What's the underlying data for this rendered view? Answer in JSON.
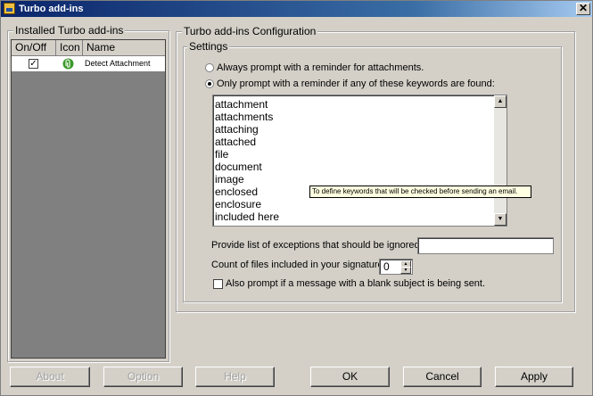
{
  "window": {
    "title": "Turbo add-ins",
    "close_glyph": "✕"
  },
  "installed": {
    "group_title": "Installed Turbo add-ins",
    "columns": [
      "On/Off",
      "Icon",
      "Name"
    ],
    "rows": [
      {
        "enabled": true,
        "icon": "paperclip-icon",
        "name": "Detect Attachment"
      }
    ]
  },
  "config": {
    "group_title": "Turbo add-ins Configuration",
    "settings_title": "Settings",
    "radio_always": "Always prompt with a reminder for attachments.",
    "radio_keywords": "Only prompt with a reminder if any of these keywords are found:",
    "selected_radio": "keywords",
    "keywords": [
      "attachment",
      "attachments",
      "attaching",
      "attached",
      "file",
      "document",
      "image",
      "enclosed",
      "enclosure",
      "included here"
    ],
    "tooltip": "To define keywords that will be checked before sending an email.",
    "exceptions_label": "Provide list of exceptions that should be ignored :",
    "exceptions_value": "",
    "signature_files_label": "Count of files included in your signature:",
    "signature_files_value": "0",
    "blank_subject_label": "Also prompt if a message with a blank subject is being sent.",
    "blank_subject_checked": false
  },
  "buttons": {
    "about": "About",
    "option": "Option",
    "help": "Help",
    "ok": "OK",
    "cancel": "Cancel",
    "apply": "Apply"
  },
  "colors": {
    "titlebar_start": "#0a246a",
    "titlebar_end": "#a6caf0",
    "face": "#d4d0c8",
    "tooltip_bg": "#ffffe1",
    "disabled_text": "#a0a0a0"
  }
}
